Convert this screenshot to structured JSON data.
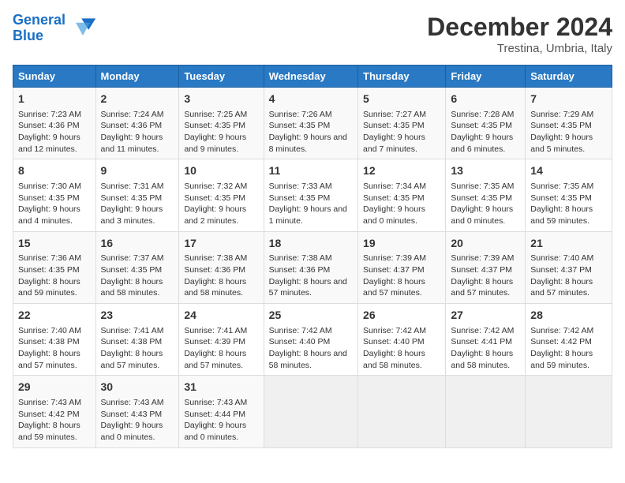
{
  "logo": {
    "line1": "General",
    "line2": "Blue"
  },
  "title": "December 2024",
  "subtitle": "Trestina, Umbria, Italy",
  "days_of_week": [
    "Sunday",
    "Monday",
    "Tuesday",
    "Wednesday",
    "Thursday",
    "Friday",
    "Saturday"
  ],
  "weeks": [
    [
      {
        "day": "1",
        "info": "Sunrise: 7:23 AM\nSunset: 4:36 PM\nDaylight: 9 hours and 12 minutes."
      },
      {
        "day": "2",
        "info": "Sunrise: 7:24 AM\nSunset: 4:36 PM\nDaylight: 9 hours and 11 minutes."
      },
      {
        "day": "3",
        "info": "Sunrise: 7:25 AM\nSunset: 4:35 PM\nDaylight: 9 hours and 9 minutes."
      },
      {
        "day": "4",
        "info": "Sunrise: 7:26 AM\nSunset: 4:35 PM\nDaylight: 9 hours and 8 minutes."
      },
      {
        "day": "5",
        "info": "Sunrise: 7:27 AM\nSunset: 4:35 PM\nDaylight: 9 hours and 7 minutes."
      },
      {
        "day": "6",
        "info": "Sunrise: 7:28 AM\nSunset: 4:35 PM\nDaylight: 9 hours and 6 minutes."
      },
      {
        "day": "7",
        "info": "Sunrise: 7:29 AM\nSunset: 4:35 PM\nDaylight: 9 hours and 5 minutes."
      }
    ],
    [
      {
        "day": "8",
        "info": "Sunrise: 7:30 AM\nSunset: 4:35 PM\nDaylight: 9 hours and 4 minutes."
      },
      {
        "day": "9",
        "info": "Sunrise: 7:31 AM\nSunset: 4:35 PM\nDaylight: 9 hours and 3 minutes."
      },
      {
        "day": "10",
        "info": "Sunrise: 7:32 AM\nSunset: 4:35 PM\nDaylight: 9 hours and 2 minutes."
      },
      {
        "day": "11",
        "info": "Sunrise: 7:33 AM\nSunset: 4:35 PM\nDaylight: 9 hours and 1 minute."
      },
      {
        "day": "12",
        "info": "Sunrise: 7:34 AM\nSunset: 4:35 PM\nDaylight: 9 hours and 0 minutes."
      },
      {
        "day": "13",
        "info": "Sunrise: 7:35 AM\nSunset: 4:35 PM\nDaylight: 9 hours and 0 minutes."
      },
      {
        "day": "14",
        "info": "Sunrise: 7:35 AM\nSunset: 4:35 PM\nDaylight: 8 hours and 59 minutes."
      }
    ],
    [
      {
        "day": "15",
        "info": "Sunrise: 7:36 AM\nSunset: 4:35 PM\nDaylight: 8 hours and 59 minutes."
      },
      {
        "day": "16",
        "info": "Sunrise: 7:37 AM\nSunset: 4:35 PM\nDaylight: 8 hours and 58 minutes."
      },
      {
        "day": "17",
        "info": "Sunrise: 7:38 AM\nSunset: 4:36 PM\nDaylight: 8 hours and 58 minutes."
      },
      {
        "day": "18",
        "info": "Sunrise: 7:38 AM\nSunset: 4:36 PM\nDaylight: 8 hours and 57 minutes."
      },
      {
        "day": "19",
        "info": "Sunrise: 7:39 AM\nSunset: 4:37 PM\nDaylight: 8 hours and 57 minutes."
      },
      {
        "day": "20",
        "info": "Sunrise: 7:39 AM\nSunset: 4:37 PM\nDaylight: 8 hours and 57 minutes."
      },
      {
        "day": "21",
        "info": "Sunrise: 7:40 AM\nSunset: 4:37 PM\nDaylight: 8 hours and 57 minutes."
      }
    ],
    [
      {
        "day": "22",
        "info": "Sunrise: 7:40 AM\nSunset: 4:38 PM\nDaylight: 8 hours and 57 minutes."
      },
      {
        "day": "23",
        "info": "Sunrise: 7:41 AM\nSunset: 4:38 PM\nDaylight: 8 hours and 57 minutes."
      },
      {
        "day": "24",
        "info": "Sunrise: 7:41 AM\nSunset: 4:39 PM\nDaylight: 8 hours and 57 minutes."
      },
      {
        "day": "25",
        "info": "Sunrise: 7:42 AM\nSunset: 4:40 PM\nDaylight: 8 hours and 58 minutes."
      },
      {
        "day": "26",
        "info": "Sunrise: 7:42 AM\nSunset: 4:40 PM\nDaylight: 8 hours and 58 minutes."
      },
      {
        "day": "27",
        "info": "Sunrise: 7:42 AM\nSunset: 4:41 PM\nDaylight: 8 hours and 58 minutes."
      },
      {
        "day": "28",
        "info": "Sunrise: 7:42 AM\nSunset: 4:42 PM\nDaylight: 8 hours and 59 minutes."
      }
    ],
    [
      {
        "day": "29",
        "info": "Sunrise: 7:43 AM\nSunset: 4:42 PM\nDaylight: 8 hours and 59 minutes."
      },
      {
        "day": "30",
        "info": "Sunrise: 7:43 AM\nSunset: 4:43 PM\nDaylight: 9 hours and 0 minutes."
      },
      {
        "day": "31",
        "info": "Sunrise: 7:43 AM\nSunset: 4:44 PM\nDaylight: 9 hours and 0 minutes."
      },
      {
        "day": "",
        "info": ""
      },
      {
        "day": "",
        "info": ""
      },
      {
        "day": "",
        "info": ""
      },
      {
        "day": "",
        "info": ""
      }
    ]
  ]
}
